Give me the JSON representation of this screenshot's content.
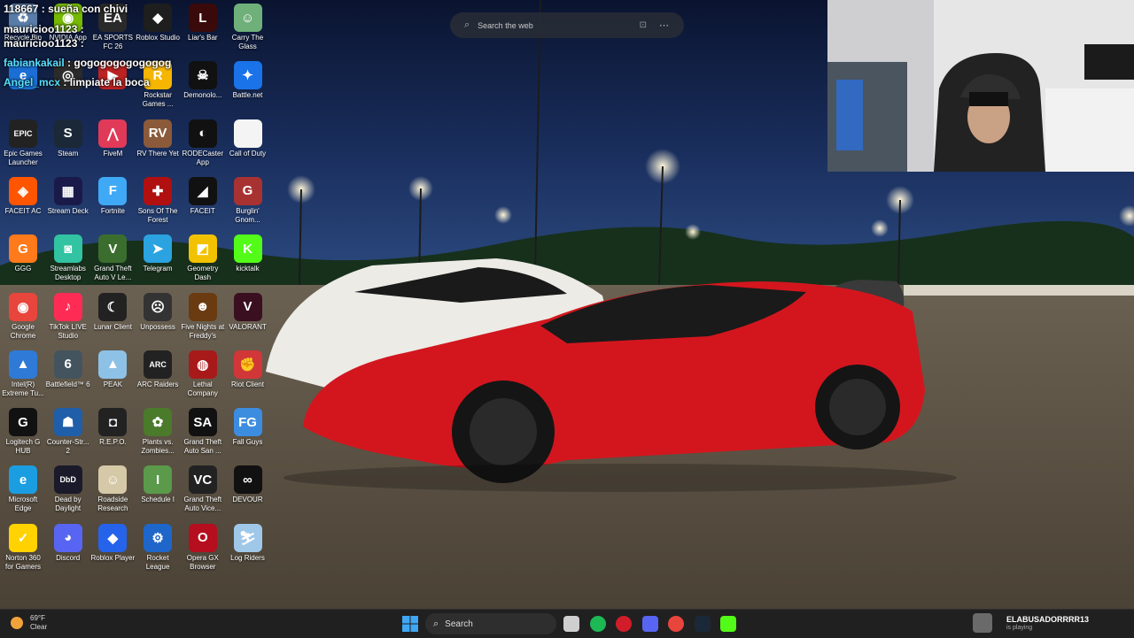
{
  "chat": {
    "lines": [
      {
        "user": "118667",
        "message": ": sueña con chivi"
      },
      {
        "user": "mauricioo1123",
        "message": ":"
      },
      {
        "user": "mauricioo1123",
        "message": ":"
      },
      {
        "user": "fabiankakail",
        "message": ": gogogogogogogog"
      },
      {
        "user": "Angel_mcx",
        "message": ": limpiate la boca"
      }
    ]
  },
  "browser_search": {
    "placeholder": "Search the web"
  },
  "desktop_icons": [
    {
      "label": "Recycle Bin",
      "icon": "recycle-bin-icon",
      "color": "#5a7da8",
      "glyph": "♻"
    },
    {
      "label": "NVIDIA App",
      "icon": "nvidia-icon",
      "color": "#76b900",
      "glyph": "◉"
    },
    {
      "label": "EA SPORTS FC 26",
      "icon": "ea-fc-icon",
      "color": "#2a2a2a",
      "glyph": "EA"
    },
    {
      "label": "Roblox Studio",
      "icon": "roblox-studio-icon",
      "color": "#1e1e1e",
      "glyph": "◆"
    },
    {
      "label": "Liar's Bar",
      "icon": "liars-bar-icon",
      "color": "#3a0a0a",
      "glyph": "L"
    },
    {
      "label": "Carry The Glass",
      "icon": "carry-the-glass-icon",
      "color": "#6fb07a",
      "glyph": "☺"
    },
    {
      "label": "",
      "icon": "edge-app-icon",
      "color": "#1b6fd4",
      "glyph": "e"
    },
    {
      "label": "",
      "icon": "obs-studio-icon",
      "color": "#2b2b2b",
      "glyph": "◎"
    },
    {
      "label": "",
      "icon": "game-icon",
      "color": "#b22",
      "glyph": "▶"
    },
    {
      "label": "Rockstar Games ...",
      "icon": "rockstar-icon",
      "color": "#f6b600",
      "glyph": "R"
    },
    {
      "label": "Demonolo...",
      "icon": "demonologist-icon",
      "color": "#111",
      "glyph": "☠"
    },
    {
      "label": "Battle.net",
      "icon": "battlenet-icon",
      "color": "#1a73e8",
      "glyph": "✦"
    },
    {
      "label": "Epic Games Launcher",
      "icon": "epic-games-icon",
      "color": "#222",
      "glyph": "EPIC"
    },
    {
      "label": "Steam",
      "icon": "steam-icon",
      "color": "#1b2838",
      "glyph": "S"
    },
    {
      "label": "FiveM",
      "icon": "fivem-icon",
      "color": "#e03a58",
      "glyph": "⋀"
    },
    {
      "label": "RV There Yet",
      "icon": "rv-there-yet-icon",
      "color": "#8a5a3a",
      "glyph": "RV"
    },
    {
      "label": "RODECaster App",
      "icon": "rodecaster-icon",
      "color": "#111",
      "glyph": "◐"
    },
    {
      "label": "Call of Duty",
      "icon": "file-icon",
      "color": "#f4f4f4",
      "glyph": ""
    },
    {
      "label": "FACEIT AC",
      "icon": "faceit-ac-icon",
      "color": "#ff5500",
      "glyph": "◈"
    },
    {
      "label": "Stream Deck",
      "icon": "stream-deck-icon",
      "color": "#1a1a4a",
      "glyph": "▦"
    },
    {
      "label": "Fortnite",
      "icon": "fortnite-icon",
      "color": "#3fa9f5",
      "glyph": "F"
    },
    {
      "label": "Sons Of The Forest",
      "icon": "sons-of-the-forest-icon",
      "color": "#b01010",
      "glyph": "✚"
    },
    {
      "label": "FACEIT",
      "icon": "faceit-icon",
      "color": "#111",
      "glyph": "◢"
    },
    {
      "label": "Burglin' Gnom...",
      "icon": "burglin-gnomes-icon",
      "color": "#a83232",
      "glyph": "G"
    },
    {
      "label": "GGG",
      "icon": "ggg-icon",
      "color": "#ff7a1a",
      "glyph": "G"
    },
    {
      "label": "Streamlabs Desktop",
      "icon": "streamlabs-icon",
      "color": "#31c3a2",
      "glyph": "◙"
    },
    {
      "label": "Grand Theft Auto V Le...",
      "icon": "gta-v-icon",
      "color": "#3b6e2e",
      "glyph": "V"
    },
    {
      "label": "Telegram",
      "icon": "telegram-icon",
      "color": "#2aa3e0",
      "glyph": "➤"
    },
    {
      "label": "Geometry Dash",
      "icon": "geometry-dash-icon",
      "color": "#f2c200",
      "glyph": "◩"
    },
    {
      "label": "kicktalk",
      "icon": "kicktalk-icon",
      "color": "#53fc18",
      "glyph": "K"
    },
    {
      "label": "Google Chrome",
      "icon": "chrome-icon",
      "color": "#e8453c",
      "glyph": "◉"
    },
    {
      "label": "TikTok LIVE Studio",
      "icon": "tiktok-live-icon",
      "color": "#fe2c55",
      "glyph": "♪"
    },
    {
      "label": "Lunar Client",
      "icon": "lunar-client-icon",
      "color": "#222",
      "glyph": "☾"
    },
    {
      "label": "Unpossess",
      "icon": "unpossess-icon",
      "color": "#333",
      "glyph": "☹"
    },
    {
      "label": "Five Nights at Freddy's",
      "icon": "fnaf-icon",
      "color": "#6a3a10",
      "glyph": "☻"
    },
    {
      "label": "VALORANT",
      "icon": "valorant-icon",
      "color": "#3a1020",
      "glyph": "V"
    },
    {
      "label": "Intel(R) Extreme Tu...",
      "icon": "intel-xtu-icon",
      "color": "#2f7ad6",
      "glyph": "▲"
    },
    {
      "label": "Battlefield™ 6",
      "icon": "battlefield-icon",
      "color": "#44545e",
      "glyph": "6"
    },
    {
      "label": "PEAK",
      "icon": "peak-icon",
      "color": "#8ec1e6",
      "glyph": "▲"
    },
    {
      "label": "ARC Raiders",
      "icon": "arc-raiders-icon",
      "color": "#222",
      "glyph": "ARC"
    },
    {
      "label": "Lethal Company",
      "icon": "lethal-company-icon",
      "color": "#a81a1a",
      "glyph": "◍"
    },
    {
      "label": "Riot Client",
      "icon": "riot-client-icon",
      "color": "#d13639",
      "glyph": "✊"
    },
    {
      "label": "Logitech G HUB",
      "icon": "logitech-ghub-icon",
      "color": "#111",
      "glyph": "G"
    },
    {
      "label": "Counter-Str... 2",
      "icon": "counter-strike-icon",
      "color": "#1f5ea8",
      "glyph": "☗"
    },
    {
      "label": "R.E.P.O.",
      "icon": "repo-icon",
      "color": "#222",
      "glyph": "◘"
    },
    {
      "label": "Plants vs. Zombies...",
      "icon": "pvz-icon",
      "color": "#4a7a2a",
      "glyph": "✿"
    },
    {
      "label": "Grand Theft Auto San ...",
      "icon": "gta-sa-icon",
      "color": "#111",
      "glyph": "SA"
    },
    {
      "label": "Fall Guys",
      "icon": "fall-guys-icon",
      "color": "#3c8de0",
      "glyph": "FG"
    },
    {
      "label": "Microsoft Edge",
      "icon": "edge-icon",
      "color": "#1b9de2",
      "glyph": "e"
    },
    {
      "label": "Dead by Daylight",
      "icon": "dead-by-daylight-icon",
      "color": "#1a1a2a",
      "glyph": "DbD"
    },
    {
      "label": "Roadside Research",
      "icon": "roadside-research-icon",
      "color": "#d6c9a8",
      "glyph": "☺"
    },
    {
      "label": "Schedule I",
      "icon": "schedule-one-icon",
      "color": "#5a9a4a",
      "glyph": "I"
    },
    {
      "label": "Grand Theft Auto Vice...",
      "icon": "gta-vice-city-icon",
      "color": "#222",
      "glyph": "VC"
    },
    {
      "label": "DEVOUR",
      "icon": "devour-icon",
      "color": "#111",
      "glyph": "∞"
    },
    {
      "label": "Norton 360 for Gamers",
      "icon": "norton-icon",
      "color": "#ffd200",
      "glyph": "✓"
    },
    {
      "label": "Discord",
      "icon": "discord-icon",
      "color": "#5865f2",
      "glyph": "◕"
    },
    {
      "label": "Roblox Player",
      "icon": "roblox-player-icon",
      "color": "#2563eb",
      "glyph": "◆"
    },
    {
      "label": "Rocket League",
      "icon": "rocket-league-icon",
      "color": "#1e66c9",
      "glyph": "⚙"
    },
    {
      "label": "Opera GX Browser",
      "icon": "opera-gx-icon",
      "color": "#b50e1e",
      "glyph": "O"
    },
    {
      "label": "Log Riders",
      "icon": "log-riders-icon",
      "color": "#9fc7e8",
      "glyph": "⛷"
    }
  ],
  "taskbar": {
    "weather_temp": "69°F",
    "weather_cond": "Clear",
    "search_label": "Search",
    "apps": [
      {
        "name": "task-view-icon",
        "color": "#cfcfcf"
      },
      {
        "name": "spotify-icon",
        "color": "#1db954"
      },
      {
        "name": "opera-gx-icon",
        "color": "#d11d2a"
      },
      {
        "name": "discord-icon",
        "color": "#5865f2"
      },
      {
        "name": "chrome-icon",
        "color": "#e8453c"
      },
      {
        "name": "steam-icon",
        "color": "#1b2838"
      },
      {
        "name": "kick-icon",
        "color": "#53fc18"
      }
    ],
    "streamer_name": "ELABUSADORRRR13",
    "streamer_status": "is playing"
  },
  "colors": {
    "taskbar": "#202020",
    "car_red": "#d3161e"
  }
}
